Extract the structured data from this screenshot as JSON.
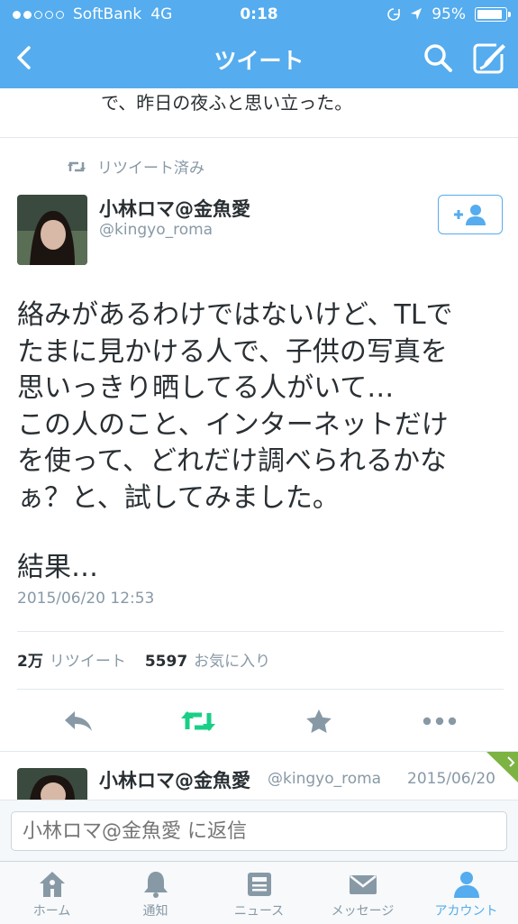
{
  "status_bar": {
    "carrier": "SoftBank",
    "network": "4G",
    "time": "0:18",
    "battery": "95%",
    "battery_level": 0.95
  },
  "nav": {
    "title": "ツイート"
  },
  "previous_tweet_tail": "で、昨日の夜ふと思い立った。",
  "retweet_context": "リツイート済み",
  "tweet": {
    "author_name": "小林ロマ@金魚愛",
    "author_handle": "@kingyo_roma",
    "text_lines": [
      "絡みがあるわけではないけど、TLで",
      "たまに見かける人で、子供の写真を",
      "思いっきり晒してる人がいて…",
      "この人のこと、インターネットだけ",
      "を使って、どれだけ調べられるかな",
      "ぁ？と、試してみました。"
    ],
    "text_result": "結果…",
    "timestamp": "2015/06/20 12:53",
    "retweet_count": "2万",
    "retweet_label": "リツイート",
    "favorite_count": "5597",
    "favorite_label": "お気に入り"
  },
  "reply_tweet": {
    "author_name": "小林ロマ@金魚愛",
    "author_handle": "@kingyo_roma",
    "date": "2015/06/20"
  },
  "reply_input": {
    "placeholder": "小林ロマ@金魚愛 に返信"
  },
  "tabs": [
    {
      "label": "ホーム",
      "icon": "home-icon"
    },
    {
      "label": "通知",
      "icon": "bell-icon"
    },
    {
      "label": "ニュース",
      "icon": "news-icon"
    },
    {
      "label": "メッセージ",
      "icon": "envelope-icon"
    },
    {
      "label": "アカウント",
      "icon": "person-icon",
      "active": true
    }
  ],
  "colors": {
    "accent": "#55acee",
    "retweet_green": "#19cf86",
    "text": "#292f33",
    "muted": "#8899a6"
  }
}
